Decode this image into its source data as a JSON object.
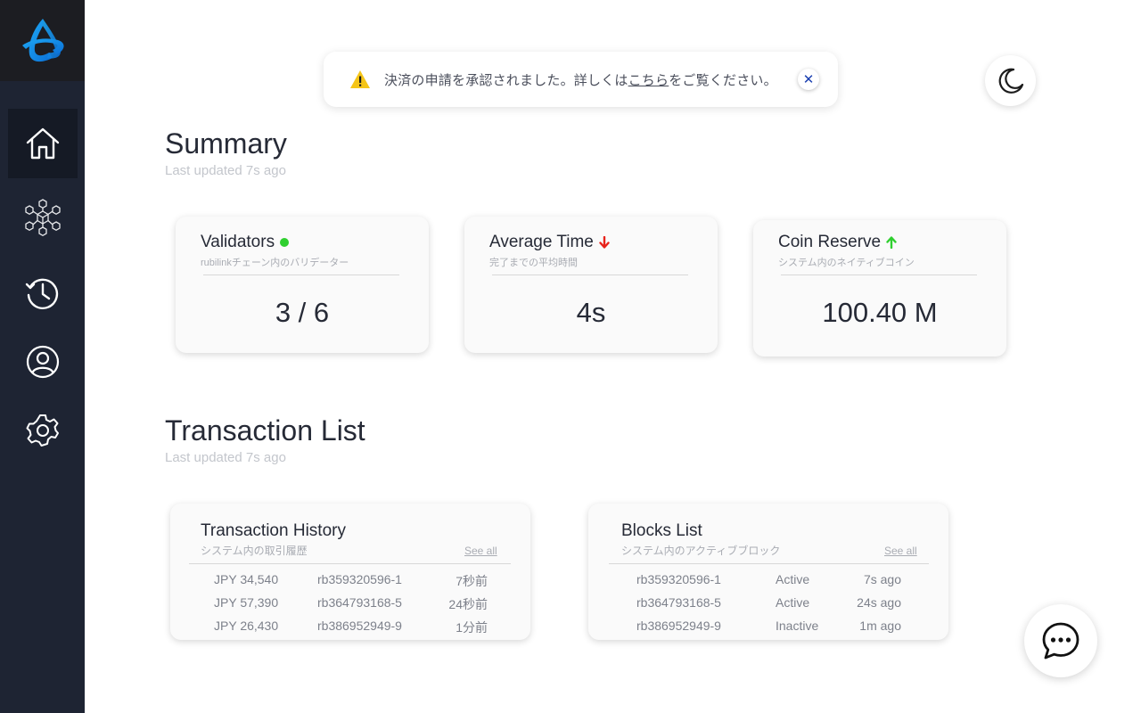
{
  "notice": {
    "message_before": "決済の申請を承認されました。詳しくは",
    "link_text": "こちら",
    "message_after": "をご覧ください。",
    "close_label": "✕"
  },
  "summary": {
    "title": "Summary",
    "updated": "Last updated 7s ago",
    "cards": [
      {
        "title": "Validators",
        "subtitle": "rubilinkチェーン内のバリデーター",
        "value": "3 / 6",
        "indicator": "green-dot"
      },
      {
        "title": "Average Time",
        "subtitle": "完了までの平均時間",
        "value": "4s",
        "indicator": "red-down-arrow"
      },
      {
        "title": "Coin Reserve",
        "subtitle": "システム内のネイティブコイン",
        "value": "100.40 M",
        "indicator": "green-up-arrow"
      }
    ]
  },
  "transactions": {
    "title": "Transaction List",
    "updated": "Last updated 7s ago"
  },
  "history": {
    "title": "Transaction History",
    "subtitle": "システム内の取引履歴",
    "see_all": "See all",
    "rows": [
      {
        "amount": "JPY 34,540",
        "id": "rb359320596-1",
        "time": "7秒前"
      },
      {
        "amount": "JPY 57,390",
        "id": "rb364793168-5",
        "time": "24秒前"
      },
      {
        "amount": "JPY 26,430",
        "id": "rb386952949-9",
        "time": "1分前"
      }
    ]
  },
  "blocks": {
    "title": "Blocks List",
    "subtitle": "システム内のアクティブブロック",
    "see_all": "See all",
    "rows": [
      {
        "id": "rb359320596-1",
        "status": "Active",
        "time": "7s ago"
      },
      {
        "id": "rb364793168-5",
        "status": "Active",
        "time": "24s ago"
      },
      {
        "id": "rb386952949-9",
        "status": "Inactive",
        "time": "1m ago"
      }
    ]
  },
  "colors": {
    "sidebar": "#1e2433",
    "accent_blue": "#1a8fe8",
    "status_green": "#2fcf2f",
    "status_red": "#e8231b"
  },
  "icons": {
    "nav": [
      "home-icon",
      "blocks-network-icon",
      "history-icon",
      "account-icon",
      "settings-icon"
    ],
    "theme": "moon-icon",
    "chat": "chat-bubble-icon",
    "notice": "warning-icon"
  }
}
